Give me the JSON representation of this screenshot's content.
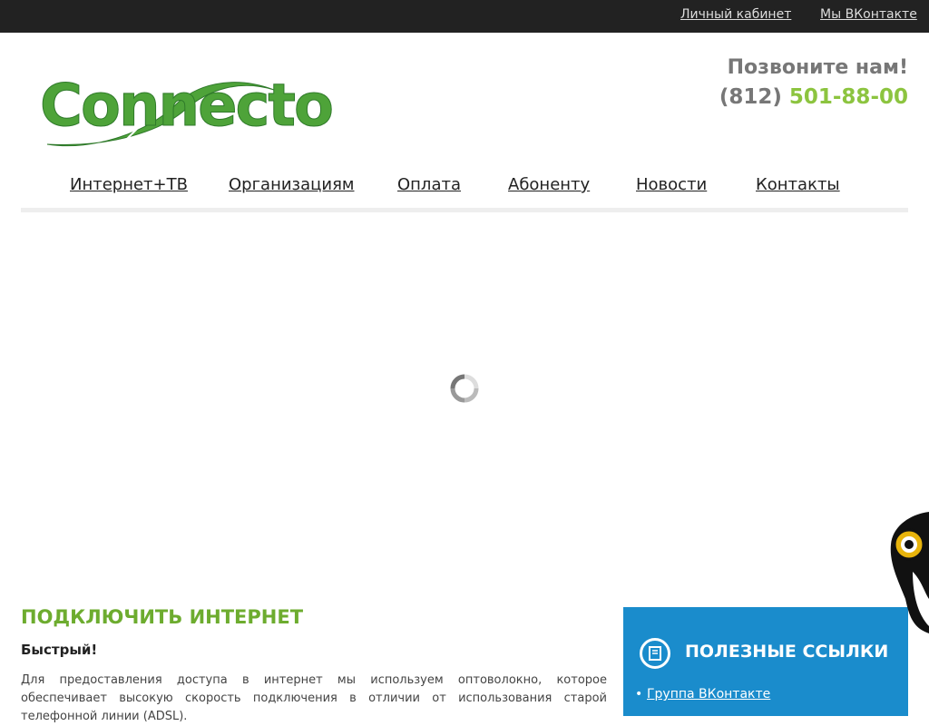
{
  "topbar": {
    "links": [
      "Личный кабинет",
      "Мы ВКонтакте"
    ]
  },
  "logo": {
    "text": "Connecto"
  },
  "call": {
    "title": "Позвоните нам!",
    "phone_code": "(812)",
    "phone_number": "501-88-00"
  },
  "nav": {
    "items": [
      "Интернет+ТВ",
      "Организациям",
      "Оплата",
      "Абоненту",
      "Новости",
      "Контакты"
    ]
  },
  "main": {
    "section_title": "ПОДКЛЮЧИТЬ ИНТЕРНЕТ",
    "subtitle": "Быстрый!",
    "paragraph": "Для предоставления доступа в интернет мы используем оптоволокно, которое обеспечивает высокую скорость подключения в отличии от использования старой телефонной линии (ADSL)."
  },
  "side_panel": {
    "title": "ПОЛЕЗНЫЕ ССЫЛКИ",
    "links": [
      "Группа ВКонтакте"
    ]
  },
  "colors": {
    "topbar": "#222222",
    "brand_green": "#4ea339",
    "accent_green": "#8cc43f",
    "panel_blue": "#1a8ccc"
  },
  "icons": [
    "spinner-icon",
    "book-icon",
    "mascot-icon"
  ]
}
